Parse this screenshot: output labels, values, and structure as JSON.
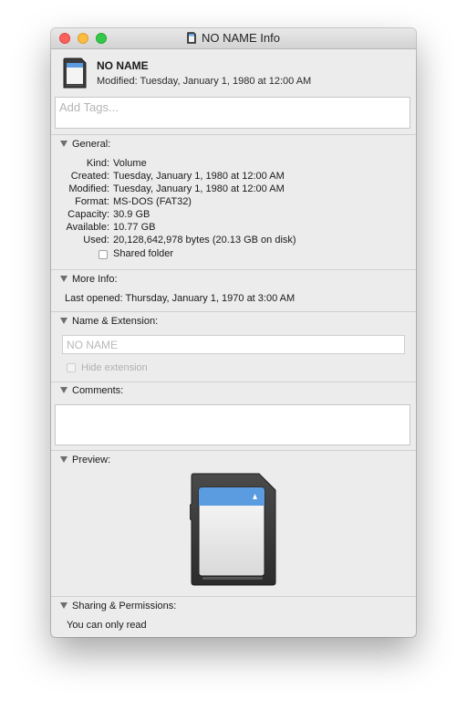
{
  "window": {
    "title": "NO NAME Info"
  },
  "header": {
    "name": "NO NAME",
    "modified_line": "Modified: Tuesday, January 1, 1980 at 12:00 AM",
    "icon": "sd-card-icon"
  },
  "tags": {
    "placeholder": "Add Tags..."
  },
  "sections": {
    "general": "General:",
    "more_info": "More Info:",
    "name_extension": "Name & Extension:",
    "comments": "Comments:",
    "preview": "Preview:",
    "sharing": "Sharing & Permissions:"
  },
  "general": {
    "rows": [
      {
        "label": "Kind:",
        "value": "Volume"
      },
      {
        "label": "Created:",
        "value": "Tuesday, January 1, 1980 at 12:00 AM"
      },
      {
        "label": "Modified:",
        "value": "Tuesday, January 1, 1980 at 12:00 AM"
      },
      {
        "label": "Format:",
        "value": "MS-DOS (FAT32)"
      },
      {
        "label": "Capacity:",
        "value": "30.9 GB"
      },
      {
        "label": "Available:",
        "value": "10.77 GB"
      },
      {
        "label": "Used:",
        "value": "20,128,642,978 bytes (20.13 GB on disk)"
      }
    ],
    "shared_folder_label": "Shared folder",
    "shared_folder_checked": false
  },
  "more_info": {
    "last_opened": "Last opened: Thursday, January 1, 1970 at 3:00 AM"
  },
  "name_extension": {
    "value": "NO NAME",
    "hide_extension_label": "Hide extension",
    "hide_extension_checked": false,
    "hide_extension_enabled": false
  },
  "comments": {
    "value": ""
  },
  "sharing": {
    "permission_text": "You can only read"
  },
  "colors": {
    "close": "#fc605c",
    "minimize": "#fdbc40",
    "maximize": "#34c84a",
    "sd_label": "#5b9be0",
    "window_bg": "#ececec"
  }
}
